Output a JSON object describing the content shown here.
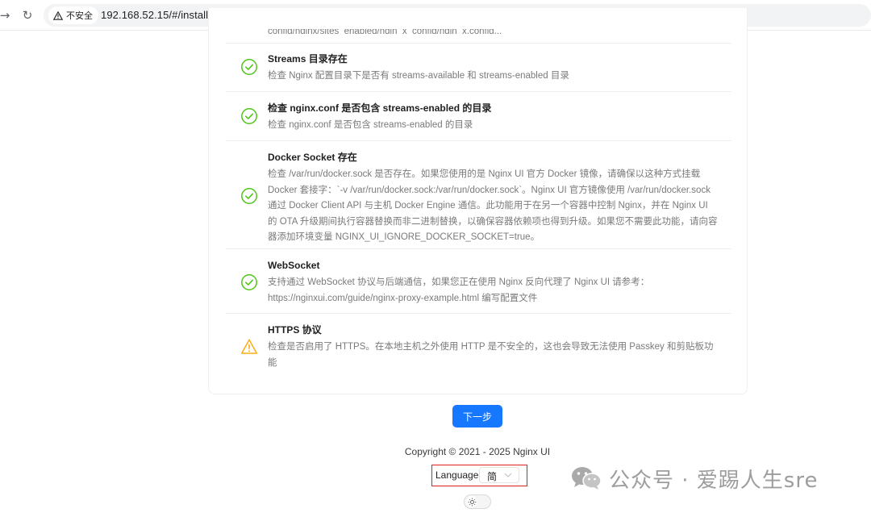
{
  "browser": {
    "nav_forward": "→",
    "nav_reload": "↻",
    "security_label": "不安全",
    "url": "192.168.52.15/#/install"
  },
  "checks": {
    "cut_off_line": "config/nginx/sites_enabled/ngin_x_config/ngin_x.config...",
    "items": [
      {
        "title": "Streams 目录存在",
        "description": "检查 Nginx 配置目录下是否有 streams-available 和 streams-enabled 目录",
        "status": "success"
      },
      {
        "title": "检查 nginx.conf 是否包含 streams-enabled 的目录",
        "description": "检查 nginx.conf 是否包含 streams-enabled 的目录",
        "status": "success"
      },
      {
        "title": "Docker Socket 存在",
        "description": "检查 /var/run/docker.sock 是否存在。如果您使用的是 Nginx UI 官方 Docker 镜像，请确保以这种方式挂载 Docker 套接字：`-v /var/run/docker.sock:/var/run/docker.sock`。Nginx UI 官方镜像使用 /var/run/docker.sock 通过 Docker Client API 与主机 Docker Engine 通信。此功能用于在另一个容器中控制 Nginx，并在 Nginx UI 的 OTA 升级期间执行容器替换而非二进制替换，以确保容器依赖项也得到升级。如果您不需要此功能，请向容器添加环境变量 NGINX_UI_IGNORE_DOCKER_SOCKET=true。",
        "status": "success"
      },
      {
        "title": "WebSocket",
        "description": "支持通过 WebSocket 协议与后端通信，如果您正在使用 Nginx 反向代理了 Nginx UI 请参考：https://nginxui.com/guide/nginx-proxy-example.html 编写配置文件",
        "status": "success"
      },
      {
        "title": "HTTPS 协议",
        "description": "检查是否启用了 HTTPS。在本地主机之外使用 HTTP 是不安全的，这也会导致无法使用 Passkey 和剪贴板功能",
        "status": "warning"
      }
    ]
  },
  "next_button": "下一步",
  "footer": {
    "copyright": "Copyright © 2021 - 2025 Nginx UI",
    "language_label": "Language",
    "language_value": "简"
  },
  "watermark": "公众号 · 爱踢人生sre",
  "colors": {
    "success": "#52c41a",
    "warning": "#faad14",
    "primary": "#1677ff",
    "highlight_box": "#e02020"
  }
}
